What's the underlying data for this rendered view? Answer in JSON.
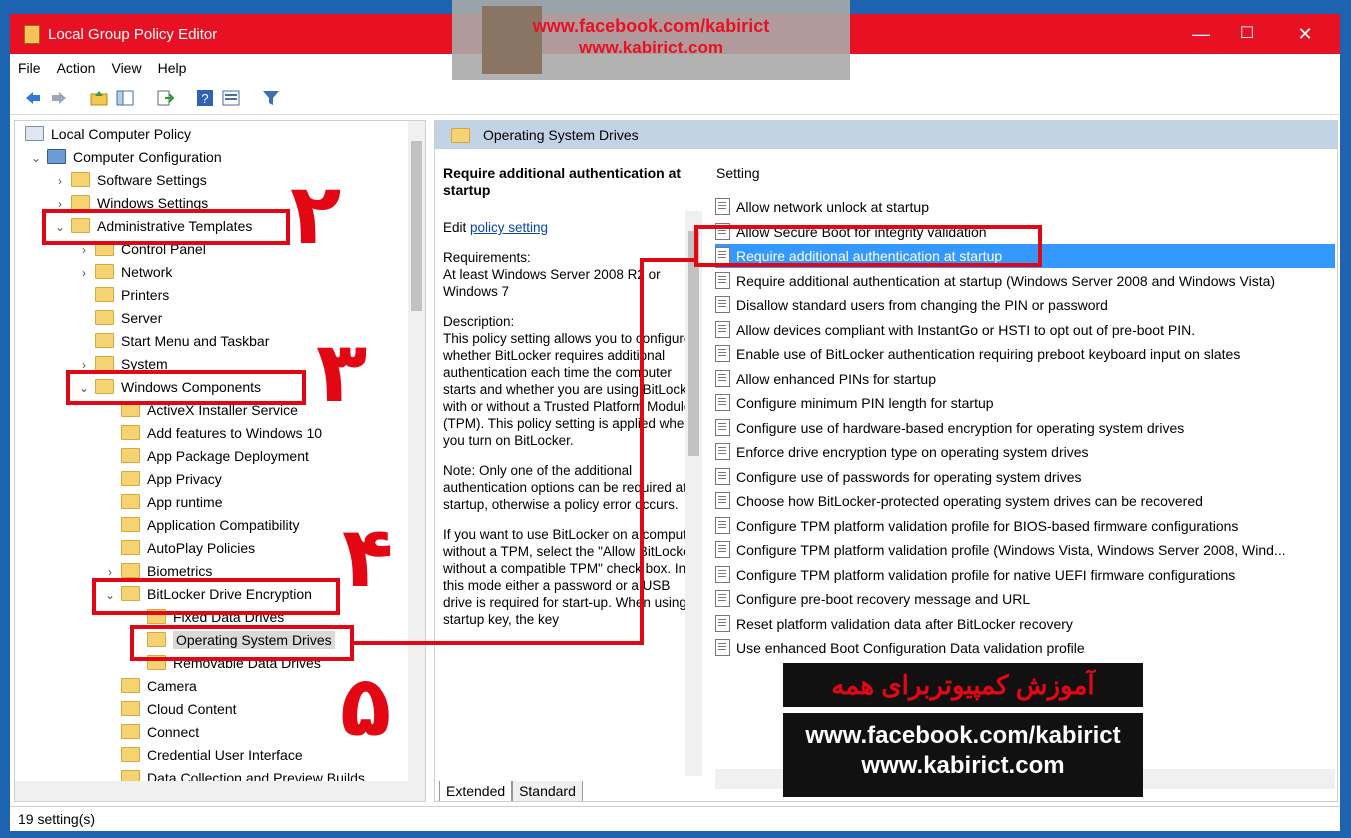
{
  "window": {
    "title": "Local Group Policy Editor",
    "minimize": "—",
    "maximize": "☐",
    "close": "✕"
  },
  "menu": [
    "File",
    "Action",
    "View",
    "Help"
  ],
  "tree": [
    {
      "label": "Local Computer Policy"
    },
    {
      "label": "Computer Configuration"
    },
    {
      "label": "Software Settings"
    },
    {
      "label": "Windows Settings"
    },
    {
      "label": "Administrative Templates"
    },
    {
      "label": "Control Panel"
    },
    {
      "label": "Network"
    },
    {
      "label": "Printers"
    },
    {
      "label": "Server"
    },
    {
      "label": "Start Menu and Taskbar"
    },
    {
      "label": "System"
    },
    {
      "label": "Windows Components"
    },
    {
      "label": "ActiveX Installer Service"
    },
    {
      "label": "Add features to Windows 10"
    },
    {
      "label": "App Package Deployment"
    },
    {
      "label": "App Privacy"
    },
    {
      "label": "App runtime"
    },
    {
      "label": "Application Compatibility"
    },
    {
      "label": "AutoPlay Policies"
    },
    {
      "label": "Biometrics"
    },
    {
      "label": "BitLocker Drive Encryption"
    },
    {
      "label": "Fixed Data Drives"
    },
    {
      "label": "Operating System Drives"
    },
    {
      "label": "Removable Data Drives"
    },
    {
      "label": "Camera"
    },
    {
      "label": "Cloud Content"
    },
    {
      "label": "Connect"
    },
    {
      "label": "Credential User Interface"
    },
    {
      "label": "Data Collection and Preview Builds"
    }
  ],
  "right": {
    "header": "Operating System Drives",
    "desc_title": "Require additional authentication at startup",
    "edit_prefix": "Edit ",
    "edit_link": "policy setting",
    "requirements": "Requirements:\nAt least Windows Server 2008 R2 or Windows 7",
    "description": "Description:\nThis policy setting allows you to configure whether BitLocker requires additional authentication each time the computer starts and whether you are using BitLocker with or without a Trusted Platform Module (TPM). This policy setting is applied when you turn on BitLocker.",
    "note": "Note: Only one of the additional authentication options can be required at startup, otherwise a policy error occurs.",
    "tpm": "If you want to use BitLocker on a computer without a TPM, select the \"Allow BitLocker without a compatible TPM\" check box. In this mode either a password or a USB drive is required for start-up. When using a startup key, the key",
    "settings_header": "Setting",
    "settings": [
      "Allow network unlock at startup",
      "Allow Secure Boot for integrity validation",
      "Require additional authentication at startup",
      "Require additional authentication at startup (Windows Server 2008 and Windows Vista)",
      "Disallow standard users from changing the PIN or password",
      "Allow devices compliant with InstantGo or HSTI to opt out of pre-boot PIN.",
      "Enable use of BitLocker authentication requiring preboot keyboard input on slates",
      "Allow enhanced PINs for startup",
      "Configure minimum PIN length for startup",
      "Configure use of hardware-based encryption for operating system drives",
      "Enforce drive encryption type on operating system drives",
      "Configure use of passwords for operating system drives",
      "Choose how BitLocker-protected operating system drives can be recovered",
      "Configure TPM platform validation profile for BIOS-based firmware configurations",
      "Configure TPM platform validation profile (Windows Vista, Windows Server 2008, Wind...",
      "Configure TPM platform validation profile for native UEFI firmware configurations",
      "Configure pre-boot recovery message and URL",
      "Reset platform validation data after BitLocker recovery",
      "Use enhanced Boot Configuration Data validation profile"
    ],
    "tabs": [
      "Extended",
      "Standard"
    ]
  },
  "status": "19 setting(s)",
  "annotations": {
    "n2": "٢",
    "n3": "٣",
    "n4": "۴",
    "n5": "۵"
  },
  "watermark": {
    "title": "آموزش کمپیوتربرای همه",
    "url1": "www.facebook.com/kabirict",
    "url2": "www.kabirict.com"
  },
  "banner": {
    "line1": "www.facebook.com/kabirict",
    "line2": "www.kabirict.com"
  },
  "colors": {
    "accent": "#e81123",
    "selection": "#3399ff",
    "annotation": "#e30613"
  }
}
